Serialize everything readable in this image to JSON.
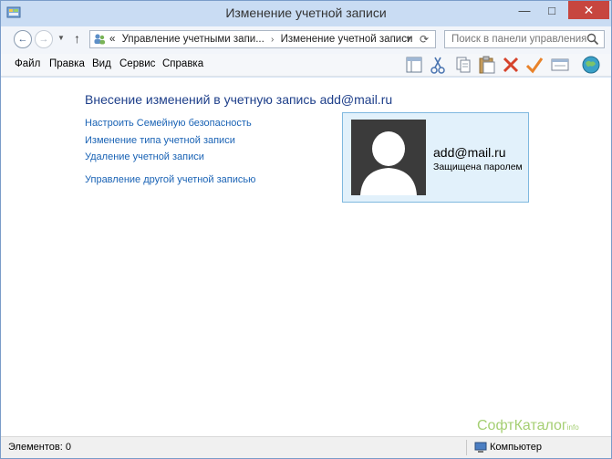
{
  "window": {
    "title": "Изменение учетной записи",
    "controls": {
      "minimize": "—",
      "maximize": "□",
      "close": "✕"
    }
  },
  "navigation": {
    "address_prefix": "«",
    "breadcrumb": [
      "Управление учетными запи...",
      "Изменение учетной записи"
    ],
    "breadcrumb_separator": "›",
    "search_placeholder": "Поиск в панели управления"
  },
  "menu": {
    "items": [
      "Файл",
      "Правка",
      "Вид",
      "Сервис",
      "Справка"
    ]
  },
  "toolbar": {
    "icons": [
      "layout-icon",
      "cut-icon",
      "copy-icon",
      "paste-icon",
      "delete-icon",
      "check-icon",
      "properties-icon",
      "globe-icon"
    ]
  },
  "main": {
    "heading": "Внесение изменений в учетную запись add@mail.ru",
    "links": [
      "Настроить Семейную безопасность",
      "Изменение типа учетной записи",
      "Удаление учетной записи",
      "Управление другой учетной записью"
    ]
  },
  "account": {
    "name": "add@mail.ru",
    "status": "Защищена паролем"
  },
  "watermark": {
    "text": "СофтКаталог",
    "suffix": "info"
  },
  "statusbar": {
    "items_count": "Элементов: 0",
    "location": "Компьютер"
  },
  "colors": {
    "titlebar": "#c9dcf3",
    "close_button": "#c7463f",
    "link": "#1a63b5",
    "heading": "#1e3f8a",
    "card_bg": "#e2f1fb",
    "card_border": "#7fb8df"
  }
}
